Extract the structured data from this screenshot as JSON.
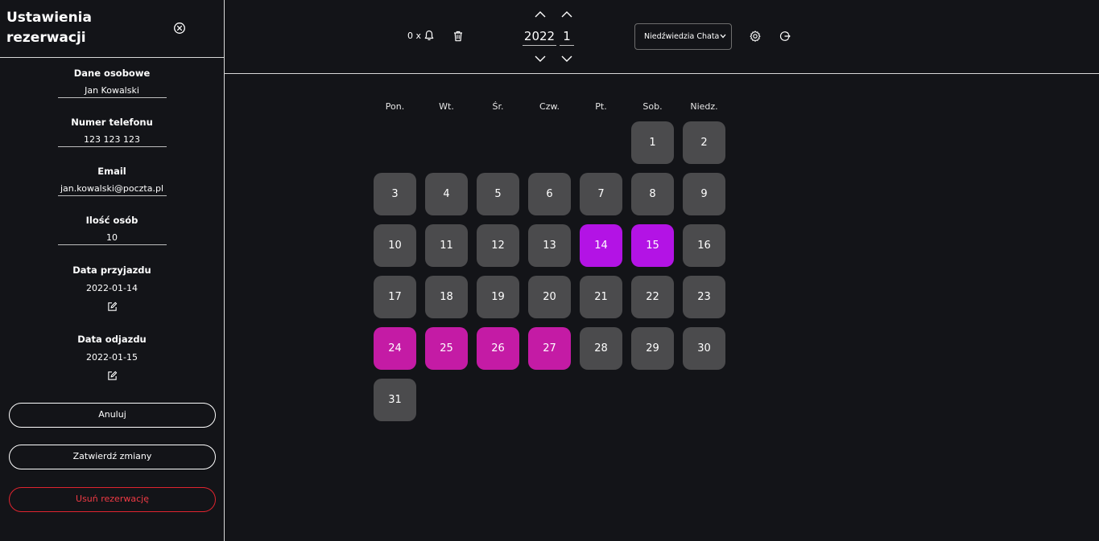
{
  "sidebar": {
    "title": "Ustawienia rezerwacji",
    "fields": [
      {
        "label": "Dane osobowe",
        "value": "Jan Kowalski"
      },
      {
        "label": "Numer telefonu",
        "value": "123 123 123"
      },
      {
        "label": "Email",
        "value": "jan.kowalski@poczta.pl"
      },
      {
        "label": "Ilość osób",
        "value": "10"
      }
    ],
    "arrival": {
      "label": "Data przyjazdu",
      "value": "2022-01-14"
    },
    "departure": {
      "label": "Data odjazdu",
      "value": "2022-01-15"
    },
    "buttons": {
      "cancel": "Anuluj",
      "confirm": "Zatwierdź zmiany",
      "delete": "Usuń rezerwację"
    }
  },
  "topbar": {
    "notifications": "0 x",
    "year": "2022",
    "month": "1",
    "property": "Niedźwiedzia Chata"
  },
  "calendar": {
    "weekdays": [
      "Pon.",
      "Wt.",
      "Śr.",
      "Czw.",
      "Pt.",
      "Sob.",
      "Niedz."
    ],
    "first_weekday_index": 5,
    "days_in_month": 31,
    "current_booking_days": [
      14,
      15
    ],
    "other_booking_days": [
      24,
      25,
      26,
      27
    ]
  },
  "colors": {
    "background": "#131418",
    "day_default": "#4b4b4d",
    "current_booking": "#b313e5",
    "other_booking": "#c41ba5",
    "danger": "#e0242f"
  }
}
